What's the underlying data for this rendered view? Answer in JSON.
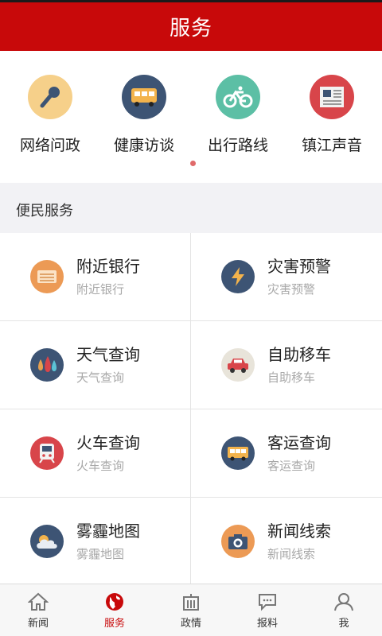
{
  "header": {
    "title": "服务"
  },
  "quick": [
    {
      "label": "网络问政",
      "icon": "microphone-icon",
      "color": "#f6d08a"
    },
    {
      "label": "健康访谈",
      "icon": "bus-icon",
      "color": "#3d5474"
    },
    {
      "label": "出行路线",
      "icon": "bicycle-icon",
      "color": "#5cbfa5"
    },
    {
      "label": "镇江声音",
      "icon": "newspaper-icon",
      "color": "#d8454a"
    }
  ],
  "section": {
    "title": "便民服务"
  },
  "services": [
    {
      "title": "附近银行",
      "sub": "附近银行",
      "icon": "bankcard-icon",
      "color": "#ec9a55"
    },
    {
      "title": "灾害预警",
      "sub": "灾害预警",
      "icon": "lightning-icon",
      "color": "#3d5474"
    },
    {
      "title": "天气查询",
      "sub": "天气查询",
      "icon": "raindrops-icon",
      "color": "#3d5474"
    },
    {
      "title": "自助移车",
      "sub": "自助移车",
      "icon": "car-icon",
      "color": "#e8e4da"
    },
    {
      "title": "火车查询",
      "sub": "火车查询",
      "icon": "train-icon",
      "color": "#d8454a"
    },
    {
      "title": "客运查询",
      "sub": "客运查询",
      "icon": "coach-icon",
      "color": "#3d5474"
    },
    {
      "title": "雾霾地图",
      "sub": "雾霾地图",
      "icon": "cloud-icon",
      "color": "#3d5474"
    },
    {
      "title": "新闻线索",
      "sub": "新闻线索",
      "icon": "camera-icon",
      "color": "#ec9a55"
    }
  ],
  "tabs": [
    {
      "label": "新闻",
      "icon": "home-icon"
    },
    {
      "label": "服务",
      "icon": "globe-icon"
    },
    {
      "label": "政情",
      "icon": "building-icon"
    },
    {
      "label": "报料",
      "icon": "chat-bubble-icon"
    },
    {
      "label": "我",
      "icon": "user-icon"
    }
  ],
  "colors": {
    "brand": "#c8090a",
    "active_tab": "#c8090a"
  }
}
